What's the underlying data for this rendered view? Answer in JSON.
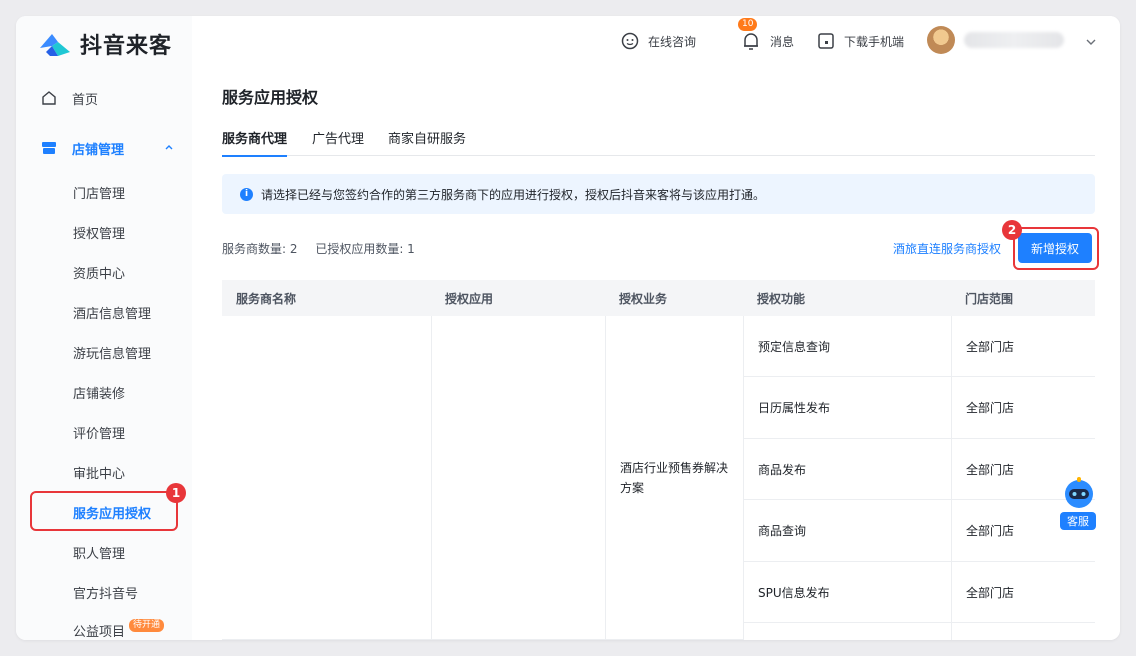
{
  "app": {
    "name": "抖音来客"
  },
  "sidebar": {
    "home": "首页",
    "store_group": "店铺管理",
    "sub_items": [
      {
        "label": "门店管理"
      },
      {
        "label": "授权管理"
      },
      {
        "label": "资质中心"
      },
      {
        "label": "酒店信息管理"
      },
      {
        "label": "游玩信息管理"
      },
      {
        "label": "店铺装修"
      },
      {
        "label": "评价管理"
      },
      {
        "label": "审批中心"
      },
      {
        "label": "服务应用授权"
      },
      {
        "label": "职人管理"
      },
      {
        "label": "官方抖音号"
      },
      {
        "label": "公益项目",
        "badge": "待开通"
      }
    ]
  },
  "header": {
    "consult": "在线咨询",
    "messages": "消息",
    "message_count": "10",
    "download": "下载手机端"
  },
  "annotations": {
    "step1": "1",
    "step2": "2"
  },
  "page": {
    "title": "服务应用授权",
    "tabs": [
      "服务商代理",
      "广告代理",
      "商家自研服务"
    ],
    "info": "请选择已经与您签约合作的第三方服务商下的应用进行授权，授权后抖音来客将与该应用打通。",
    "stats": {
      "providers": "服务商数量: 2",
      "apps": "已授权应用数量: 1"
    },
    "link": "酒旅直连服务商授权",
    "add_button": "新增授权"
  },
  "table": {
    "columns": [
      "服务商名称",
      "授权应用",
      "授权业务",
      "授权功能",
      "门店范围"
    ],
    "business": "酒店行业预售券解决方案",
    "rows": [
      {
        "feature": "预定信息查询",
        "scope": "全部门店"
      },
      {
        "feature": "日历属性发布",
        "scope": "全部门店"
      },
      {
        "feature": "商品发布",
        "scope": "全部门店"
      },
      {
        "feature": "商品查询",
        "scope": "全部门店"
      },
      {
        "feature": "SPU信息发布",
        "scope": "全部门店"
      }
    ]
  },
  "support": {
    "label": "客服"
  },
  "colors": {
    "accent": "#1e80ff",
    "highlight": "#e8363a"
  }
}
